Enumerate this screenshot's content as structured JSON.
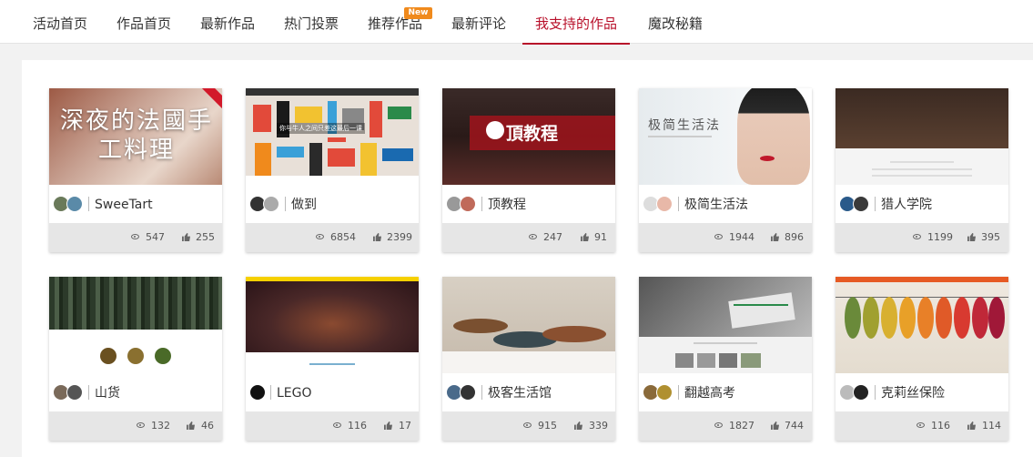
{
  "nav": {
    "items": [
      "活动首页",
      "作品首页",
      "最新作品",
      "热门投票",
      "推荐作品",
      "最新评论",
      "我支持的作品",
      "魔改秘籍"
    ],
    "active_index": 6,
    "badge": "New",
    "accent_color": "#b8102a",
    "badge_color": "#f08a1c"
  },
  "thumb_text": {
    "t1": "深夜的法國手工料理",
    "t2": "你与牛人之间只差这最后一课",
    "t3": "頂教程",
    "t4": "极简生活法"
  },
  "cards": [
    {
      "title": "SweeTart",
      "views": "547",
      "likes": "255",
      "avatars": 2
    },
    {
      "title": "做到",
      "views": "6854",
      "likes": "2399",
      "avatars": 2
    },
    {
      "title": "顶教程",
      "views": "247",
      "likes": "91",
      "avatars": 2
    },
    {
      "title": "极简生活法",
      "views": "1944",
      "likes": "896",
      "avatars": 2
    },
    {
      "title": "猎人学院",
      "views": "1199",
      "likes": "395",
      "avatars": 2
    },
    {
      "title": "山货",
      "views": "132",
      "likes": "46",
      "avatars": 2
    },
    {
      "title": "LEGO",
      "views": "116",
      "likes": "17",
      "avatars": 1
    },
    {
      "title": "极客生活馆",
      "views": "915",
      "likes": "339",
      "avatars": 2
    },
    {
      "title": "翻越高考",
      "views": "1827",
      "likes": "744",
      "avatars": 2
    },
    {
      "title": "克莉丝保险",
      "views": "116",
      "likes": "114",
      "avatars": 2
    }
  ],
  "icons": {
    "views": "eye-icon",
    "likes": "thumbs-up-icon"
  }
}
